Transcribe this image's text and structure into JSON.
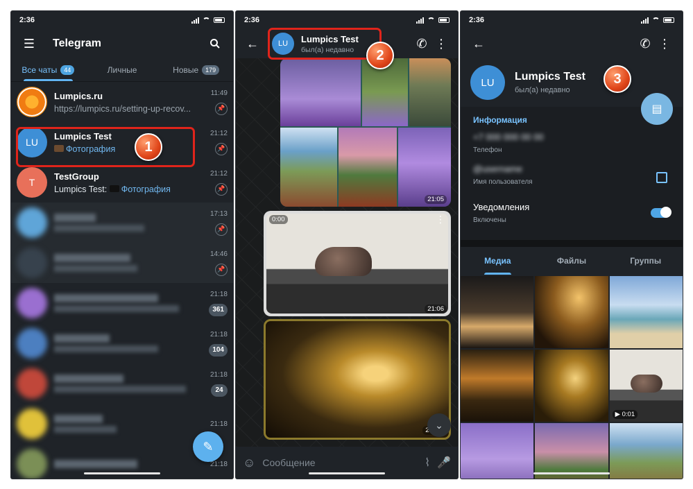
{
  "status": {
    "time": "2:36"
  },
  "panel1": {
    "app_title": "Telegram",
    "tabs": [
      {
        "label": "Все чаты",
        "badge": "44"
      },
      {
        "label": "Личные",
        "badge": ""
      },
      {
        "label": "Новые",
        "badge": "179"
      }
    ],
    "chats": [
      {
        "name": "Lumpics.ru",
        "message": "https://lumpics.ru/setting-up-recov...",
        "time": "11:49",
        "avatar": ""
      },
      {
        "name": "Lumpics Test",
        "message": "Фотография",
        "time": "21:12",
        "avatar": "LU"
      },
      {
        "name": "TestGroup",
        "message_prefix": "Lumpics Test:",
        "message": "Фотография",
        "time": "21:12",
        "avatar": "T"
      },
      {
        "time": "17:13"
      },
      {
        "time": "14:46"
      },
      {
        "time": "21:18",
        "count": "361"
      },
      {
        "time": "21:18",
        "count": "104"
      },
      {
        "time": "21:18",
        "count": "24"
      },
      {
        "time": "21:18"
      },
      {
        "time": "21:18"
      }
    ],
    "marker": "1"
  },
  "panel2": {
    "chat_name": "Lumpics Test",
    "chat_status": "был(а) недавно",
    "avatar": "LU",
    "album_time": "21:05",
    "video_duration": "0:00",
    "video_time": "21:06",
    "photo_time": "21:06",
    "input_placeholder": "Сообщение",
    "marker": "2"
  },
  "panel3": {
    "name": "Lumpics Test",
    "status": "был(а) недавно",
    "avatar": "LU",
    "info_title": "Информация",
    "phone_value": "+7 000 000 00 00",
    "phone_label": "Телефон",
    "username_value": "@username",
    "username_label": "Имя пользователя",
    "notif_label": "Уведомления",
    "notif_sub": "Включены",
    "tabs": [
      "Медиа",
      "Файлы",
      "Группы"
    ],
    "media_duration": "0:01",
    "marker": "3"
  },
  "colors": {
    "accent": "#62b4f2",
    "background": "#1f2328",
    "marker": "#e0461a",
    "frame": "#e0241b"
  }
}
